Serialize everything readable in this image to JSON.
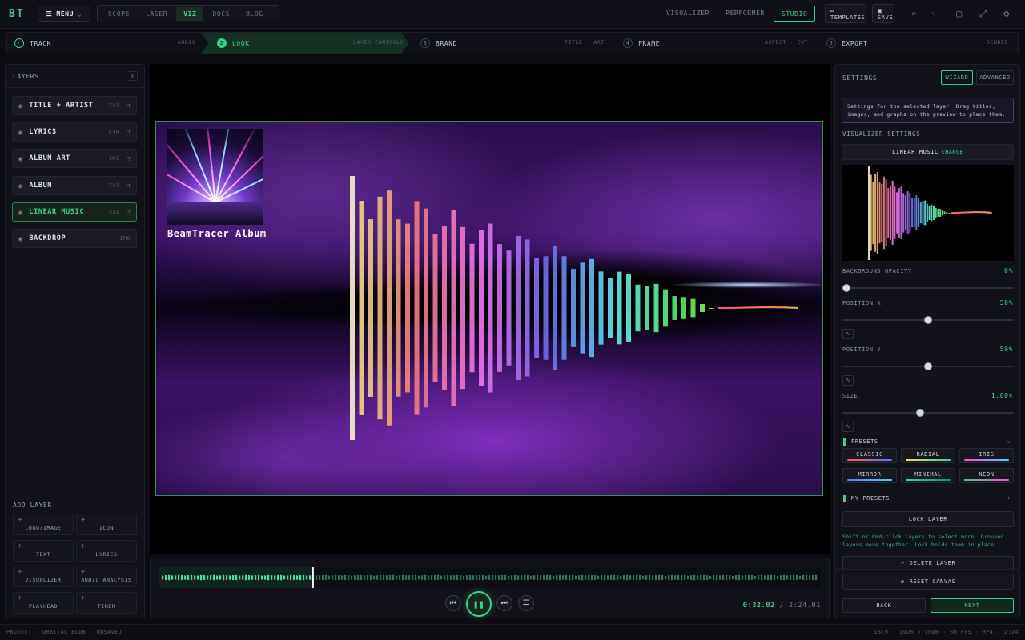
{
  "app": {
    "logo": "BT",
    "menu_label": "MENU"
  },
  "nav": [
    {
      "label": "SCOPE"
    },
    {
      "label": "LASER"
    },
    {
      "label": "VIZ",
      "active": true
    },
    {
      "label": "DOCS"
    },
    {
      "label": "BLOG"
    }
  ],
  "modes": [
    {
      "label": "VISUALIZER"
    },
    {
      "label": "PERFORMER"
    },
    {
      "label": "STUDIO",
      "active": true
    }
  ],
  "toolbar": {
    "templates_label": "TEMPLATES",
    "save_label": "SAVE"
  },
  "steps": [
    {
      "num": "✓",
      "label": "TRACK",
      "sub": "AUDIO",
      "state": "done"
    },
    {
      "num": "2",
      "label": "LOOK",
      "sub": "LAYER CONTROLS",
      "state": "active"
    },
    {
      "num": "3",
      "label": "BRAND",
      "sub": "TITLE · ART",
      "state": "todo"
    },
    {
      "num": "4",
      "label": "FRAME",
      "sub": "ASPECT · CUT",
      "state": "todo"
    },
    {
      "num": "5",
      "label": "EXPORT",
      "sub": "RENDER",
      "state": "todo"
    }
  ],
  "layers": {
    "title": "LAYERS",
    "count": "6",
    "items": [
      {
        "name": "TITLE + ARTIST",
        "tag": "TXT",
        "selected": false,
        "locked": true
      },
      {
        "name": "LYRICS",
        "tag": "LYR",
        "selected": false,
        "locked": true
      },
      {
        "name": "ALBUM ART",
        "tag": "IMG",
        "selected": false,
        "locked": true
      },
      {
        "name": "ALBUM",
        "tag": "TXT",
        "selected": false,
        "locked": true
      },
      {
        "name": "LINEAR MUSIC",
        "tag": "VIZ",
        "selected": true,
        "locked": true
      },
      {
        "name": "BACKDROP",
        "tag": "IMG",
        "selected": false,
        "locked": false
      }
    ]
  },
  "add_layer": {
    "title": "ADD LAYER",
    "items": [
      "LOGO/IMAGE",
      "ICON",
      "TEXT",
      "LYRICS",
      "VISUALIZER",
      "AUDIO ANALYSIS",
      "PLAYHEAD",
      "TIMER"
    ]
  },
  "canvas": {
    "album_title": "BeamTracer Album"
  },
  "transport": {
    "current": "0:32.02",
    "separator": "/",
    "total": "2:24.01",
    "progress": 0.232
  },
  "settings": {
    "title": "SETTINGS",
    "mode_wizard": "WIZARD",
    "mode_advanced": "ADVANCED",
    "hint": "Settings for the selected layer. Drag titles, images, and graphs on the preview to place them.",
    "viz_header": "VISUALIZER SETTINGS",
    "viz_name": "LINEAR MUSIC",
    "change_label": "CHANGE",
    "bg_opacity": {
      "label": "BACKGROUND OPACITY",
      "value": "0%",
      "fraction": 0.0
    },
    "pos_x": {
      "label": "POSITION X",
      "value": "50%",
      "fraction": 0.5
    },
    "pos_y": {
      "label": "POSITION Y",
      "value": "50%",
      "fraction": 0.5
    },
    "size": {
      "label": "SIZE",
      "value": "1.00×",
      "fraction": 0.45
    },
    "presets_header": "PRESETS",
    "presets": [
      {
        "label": "CLASSIC",
        "colors": [
          "#ff5a5a",
          "#5a7bff"
        ]
      },
      {
        "label": "RADIAL",
        "colors": [
          "#ffd84d",
          "#36d3a0"
        ]
      },
      {
        "label": "IRIS",
        "colors": [
          "#ff4fd8",
          "#4fd0ff"
        ]
      },
      {
        "label": "MIRROR",
        "colors": [
          "#5a7bff",
          "#4fd0ff"
        ]
      },
      {
        "label": "MINIMAL",
        "colors": [
          "#36d3a0",
          "#1a8f70"
        ]
      },
      {
        "label": "NEON",
        "colors": [
          "#36d387",
          "#ff4fd8"
        ]
      }
    ],
    "my_presets": "MY PRESETS",
    "lock_layer": "LOCK LAYER",
    "group_hint": "Shift or Cmd-click layers to select more. Grouped layers move together. Lock holds them in place.",
    "delete_layer": "DELETE LAYER",
    "reset_canvas": "RESET CANVAS",
    "back": "BACK",
    "next": "NEXT"
  },
  "footer": {
    "left": "PROJECT · ORBITAL BLOB · UNSAVED",
    "right": "16:9 · 1920 × 1080 · 30 FPS · MP4 · 2:24"
  },
  "colors": {
    "accent": "#36d387",
    "bg": "#0c0d12",
    "panel": "#12131a"
  }
}
